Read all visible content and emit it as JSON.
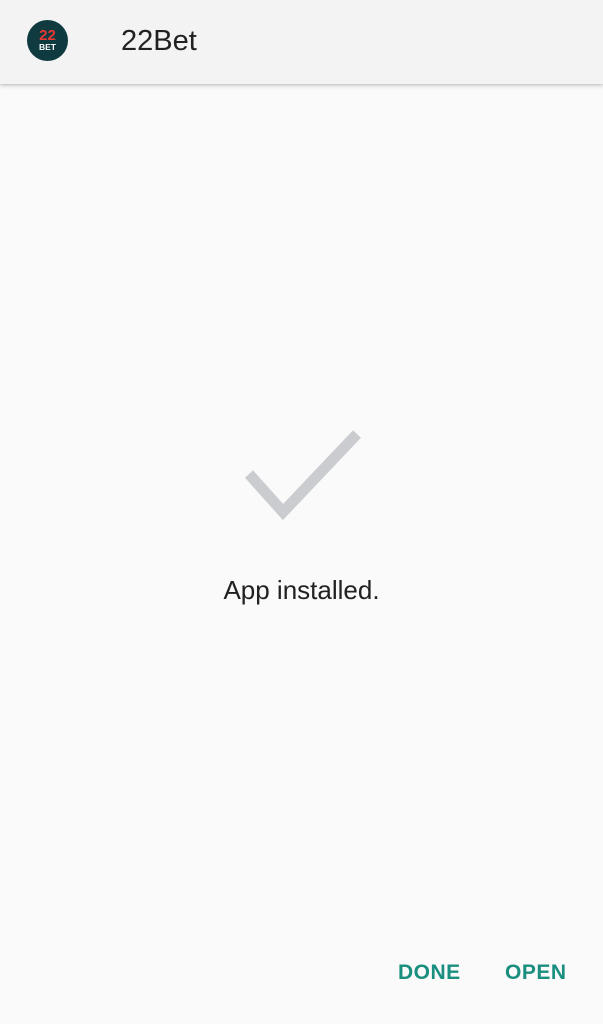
{
  "header": {
    "app_name": "22Bet",
    "icon": {
      "name": "22bet-logo-icon",
      "logo_text_top": "22",
      "logo_text_bottom": "BET",
      "background_color": "#0f3a3f",
      "accent_color": "#e53935"
    }
  },
  "main": {
    "status_icon": "checkmark-icon",
    "status_text": "App installed."
  },
  "actions": {
    "done_label": "DONE",
    "open_label": "OPEN",
    "accent_color": "#1a8f7f"
  }
}
